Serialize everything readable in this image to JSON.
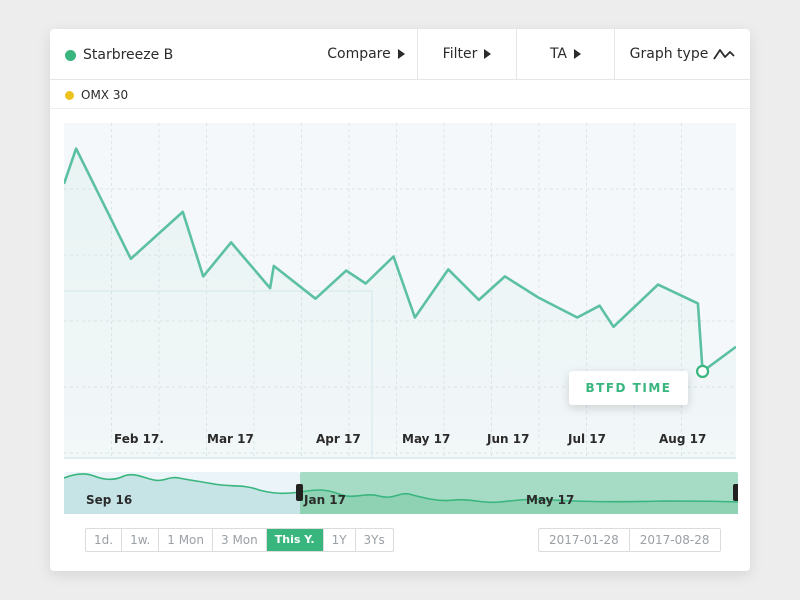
{
  "toolbar": {
    "instrument": "Starbreeze B",
    "compare_label": "Compare",
    "filter_label": "Filter",
    "ta_label": "TA",
    "graph_type_label": "Graph type",
    "graph_type_icon": "line-chart-icon"
  },
  "legend": [
    {
      "label": "OMX 30",
      "color": "#ecc21d"
    }
  ],
  "colors": {
    "accent": "#39b57e",
    "line": "#5cc0a2",
    "secondary": "#ecc21d"
  },
  "chart_data": {
    "type": "line",
    "series": [
      {
        "name": "Starbreeze B",
        "values": [
          15.5,
          18.5,
          9.1,
          13.1,
          7.6,
          10.5,
          6.6,
          8.5,
          5.7,
          8.1,
          7.0,
          9.3,
          4.1,
          8.2,
          5.6,
          7.6,
          5.8,
          4.1,
          5.1,
          3.3,
          6.9,
          5.3,
          -0.5,
          1.6
        ]
      },
      {
        "name": "OMX 30",
        "values": []
      }
    ],
    "x_tick_labels": [
      "Feb 17.",
      "Mar 17",
      "Apr 17",
      "May 17",
      "Jun 17",
      "Jul 17",
      "Aug 17"
    ],
    "annotation": "BTFD TIME",
    "grid": true,
    "navigator_labels": [
      "Sep 16",
      "Jan 17",
      "May 17"
    ]
  },
  "range_buttons": [
    "1d.",
    "1w.",
    "1 Mon",
    "3 Mon",
    "This Y.",
    "1Y",
    "3Ys"
  ],
  "range_active": "This Y.",
  "date_range": {
    "from": "2017-01-28",
    "to": "2017-08-28"
  }
}
